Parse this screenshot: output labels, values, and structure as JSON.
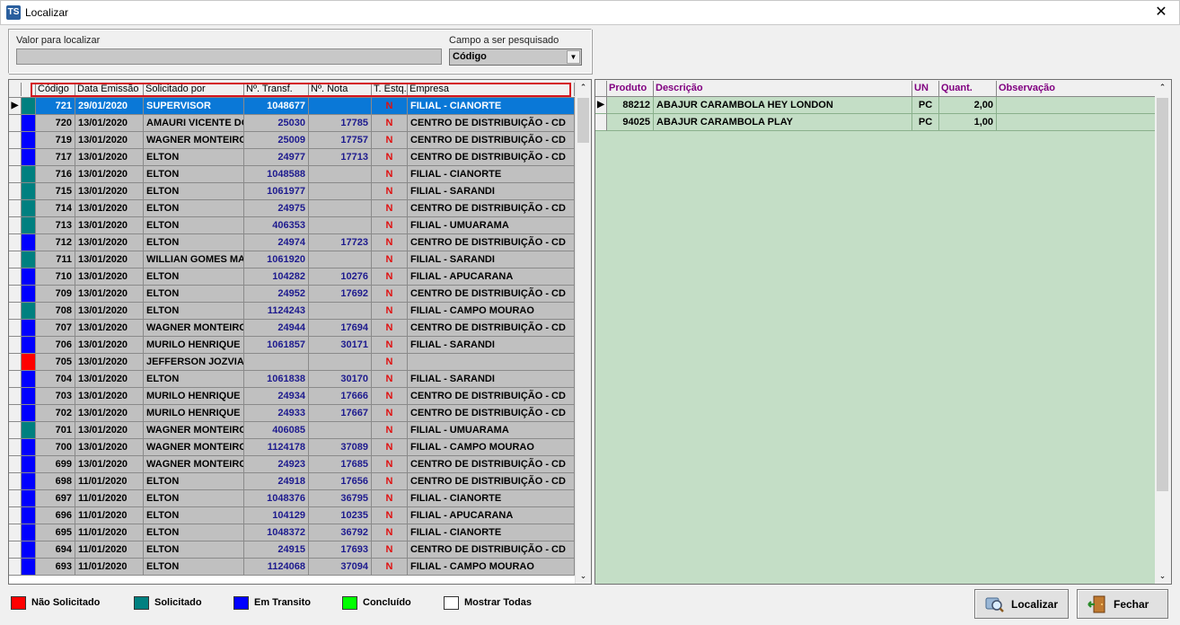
{
  "window": {
    "title": "Localizar",
    "icon_text": "TS",
    "close_glyph": "✕"
  },
  "search": {
    "valor_label": "Valor para localizar",
    "valor_value": "",
    "campo_label": "Campo a ser pesquisado",
    "campo_value": "Código"
  },
  "left_grid": {
    "columns": [
      "Código",
      "Data Emissão",
      "Solicitado por",
      "Nº. Transf.",
      "Nº. Nota",
      "T. Estq.",
      "Empresa"
    ],
    "rows": [
      {
        "status": "solicitado",
        "codigo": "721",
        "data": "29/01/2020",
        "solicitado": "SUPERVISOR",
        "transf": "1048677",
        "nota": "",
        "estq": "N",
        "empresa": "FILIAL - CIANORTE",
        "selected": true
      },
      {
        "status": "transito",
        "codigo": "720",
        "data": "13/01/2020",
        "solicitado": "AMAURI VICENTE DO",
        "transf": "25030",
        "nota": "17785",
        "estq": "N",
        "empresa": "CENTRO DE DISTRIBUIÇÃO - CD"
      },
      {
        "status": "transito",
        "codigo": "719",
        "data": "13/01/2020",
        "solicitado": "WAGNER MONTEIRO",
        "transf": "25009",
        "nota": "17757",
        "estq": "N",
        "empresa": "CENTRO DE DISTRIBUIÇÃO - CD"
      },
      {
        "status": "transito",
        "codigo": "717",
        "data": "13/01/2020",
        "solicitado": "ELTON",
        "transf": "24977",
        "nota": "17713",
        "estq": "N",
        "empresa": "CENTRO DE DISTRIBUIÇÃO - CD"
      },
      {
        "status": "solicitado",
        "codigo": "716",
        "data": "13/01/2020",
        "solicitado": "ELTON",
        "transf": "1048588",
        "nota": "",
        "estq": "N",
        "empresa": "FILIAL - CIANORTE"
      },
      {
        "status": "solicitado",
        "codigo": "715",
        "data": "13/01/2020",
        "solicitado": "ELTON",
        "transf": "1061977",
        "nota": "",
        "estq": "N",
        "empresa": "FILIAL - SARANDI"
      },
      {
        "status": "solicitado",
        "codigo": "714",
        "data": "13/01/2020",
        "solicitado": "ELTON",
        "transf": "24975",
        "nota": "",
        "estq": "N",
        "empresa": "CENTRO DE DISTRIBUIÇÃO - CD"
      },
      {
        "status": "solicitado",
        "codigo": "713",
        "data": "13/01/2020",
        "solicitado": "ELTON",
        "transf": "406353",
        "nota": "",
        "estq": "N",
        "empresa": "FILIAL - UMUARAMA"
      },
      {
        "status": "transito",
        "codigo": "712",
        "data": "13/01/2020",
        "solicitado": "ELTON",
        "transf": "24974",
        "nota": "17723",
        "estq": "N",
        "empresa": "CENTRO DE DISTRIBUIÇÃO - CD"
      },
      {
        "status": "solicitado",
        "codigo": "711",
        "data": "13/01/2020",
        "solicitado": "WILLIAN GOMES MA",
        "transf": "1061920",
        "nota": "",
        "estq": "N",
        "empresa": "FILIAL - SARANDI"
      },
      {
        "status": "transito",
        "codigo": "710",
        "data": "13/01/2020",
        "solicitado": "ELTON",
        "transf": "104282",
        "nota": "10276",
        "estq": "N",
        "empresa": "FILIAL - APUCARANA"
      },
      {
        "status": "transito",
        "codigo": "709",
        "data": "13/01/2020",
        "solicitado": "ELTON",
        "transf": "24952",
        "nota": "17692",
        "estq": "N",
        "empresa": "CENTRO DE DISTRIBUIÇÃO - CD"
      },
      {
        "status": "solicitado",
        "codigo": "708",
        "data": "13/01/2020",
        "solicitado": "ELTON",
        "transf": "1124243",
        "nota": "",
        "estq": "N",
        "empresa": "FILIAL - CAMPO MOURAO"
      },
      {
        "status": "transito",
        "codigo": "707",
        "data": "13/01/2020",
        "solicitado": "WAGNER MONTEIRO",
        "transf": "24944",
        "nota": "17694",
        "estq": "N",
        "empresa": "CENTRO DE DISTRIBUIÇÃO - CD"
      },
      {
        "status": "transito",
        "codigo": "706",
        "data": "13/01/2020",
        "solicitado": "MURILO HENRIQUE DE",
        "transf": "1061857",
        "nota": "30171",
        "estq": "N",
        "empresa": "FILIAL - SARANDI"
      },
      {
        "status": "nao",
        "codigo": "705",
        "data": "13/01/2020",
        "solicitado": "JEFFERSON JOZVIAK",
        "transf": "",
        "nota": "",
        "estq": "N",
        "empresa": ""
      },
      {
        "status": "transito",
        "codigo": "704",
        "data": "13/01/2020",
        "solicitado": "ELTON",
        "transf": "1061838",
        "nota": "30170",
        "estq": "N",
        "empresa": "FILIAL - SARANDI"
      },
      {
        "status": "transito",
        "codigo": "703",
        "data": "13/01/2020",
        "solicitado": "MURILO HENRIQUE DE",
        "transf": "24934",
        "nota": "17666",
        "estq": "N",
        "empresa": "CENTRO DE DISTRIBUIÇÃO - CD"
      },
      {
        "status": "transito",
        "codigo": "702",
        "data": "13/01/2020",
        "solicitado": "MURILO HENRIQUE DE",
        "transf": "24933",
        "nota": "17667",
        "estq": "N",
        "empresa": "CENTRO DE DISTRIBUIÇÃO - CD"
      },
      {
        "status": "solicitado",
        "codigo": "701",
        "data": "13/01/2020",
        "solicitado": "WAGNER MONTEIRO",
        "transf": "406085",
        "nota": "",
        "estq": "N",
        "empresa": "FILIAL - UMUARAMA"
      },
      {
        "status": "transito",
        "codigo": "700",
        "data": "13/01/2020",
        "solicitado": "WAGNER MONTEIRO",
        "transf": "1124178",
        "nota": "37089",
        "estq": "N",
        "empresa": "FILIAL - CAMPO MOURAO"
      },
      {
        "status": "transito",
        "codigo": "699",
        "data": "13/01/2020",
        "solicitado": "WAGNER MONTEIRO",
        "transf": "24923",
        "nota": "17685",
        "estq": "N",
        "empresa": "CENTRO DE DISTRIBUIÇÃO - CD"
      },
      {
        "status": "transito",
        "codigo": "698",
        "data": "11/01/2020",
        "solicitado": "ELTON",
        "transf": "24918",
        "nota": "17656",
        "estq": "N",
        "empresa": "CENTRO DE DISTRIBUIÇÃO - CD"
      },
      {
        "status": "transito",
        "codigo": "697",
        "data": "11/01/2020",
        "solicitado": "ELTON",
        "transf": "1048376",
        "nota": "36795",
        "estq": "N",
        "empresa": "FILIAL - CIANORTE"
      },
      {
        "status": "transito",
        "codigo": "696",
        "data": "11/01/2020",
        "solicitado": "ELTON",
        "transf": "104129",
        "nota": "10235",
        "estq": "N",
        "empresa": "FILIAL - APUCARANA"
      },
      {
        "status": "transito",
        "codigo": "695",
        "data": "11/01/2020",
        "solicitado": "ELTON",
        "transf": "1048372",
        "nota": "36792",
        "estq": "N",
        "empresa": "FILIAL - CIANORTE"
      },
      {
        "status": "transito",
        "codigo": "694",
        "data": "11/01/2020",
        "solicitado": "ELTON",
        "transf": "24915",
        "nota": "17693",
        "estq": "N",
        "empresa": "CENTRO DE DISTRIBUIÇÃO - CD"
      },
      {
        "status": "transito",
        "codigo": "693",
        "data": "11/01/2020",
        "solicitado": "ELTON",
        "transf": "1124068",
        "nota": "37094",
        "estq": "N",
        "empresa": "FILIAL - CAMPO MOURAO"
      }
    ]
  },
  "right_grid": {
    "columns": [
      "Produto",
      "Descrição",
      "UN",
      "Quant.",
      "Observação"
    ],
    "rows": [
      {
        "produto": "88212",
        "descricao": "ABAJUR CARAMBOLA HEY LONDON",
        "un": "PC",
        "quant": "2,00",
        "obs": "",
        "current": true
      },
      {
        "produto": "94025",
        "descricao": "ABAJUR CARAMBOLA PLAY",
        "un": "PC",
        "quant": "1,00",
        "obs": ""
      }
    ]
  },
  "legend": [
    {
      "key": "nao",
      "label": "Não Solicitado",
      "color": "#ff0000"
    },
    {
      "key": "solicitado",
      "label": "Solicitado",
      "color": "#008080"
    },
    {
      "key": "transito",
      "label": "Em Transito",
      "color": "#0000ff"
    },
    {
      "key": "concluido",
      "label": "Concluído",
      "color": "#00ff00"
    },
    {
      "key": "todas",
      "label": "Mostrar Todas",
      "color": "#ffffff"
    }
  ],
  "buttons": {
    "localizar": "Localizar",
    "fechar": "Fechar"
  }
}
